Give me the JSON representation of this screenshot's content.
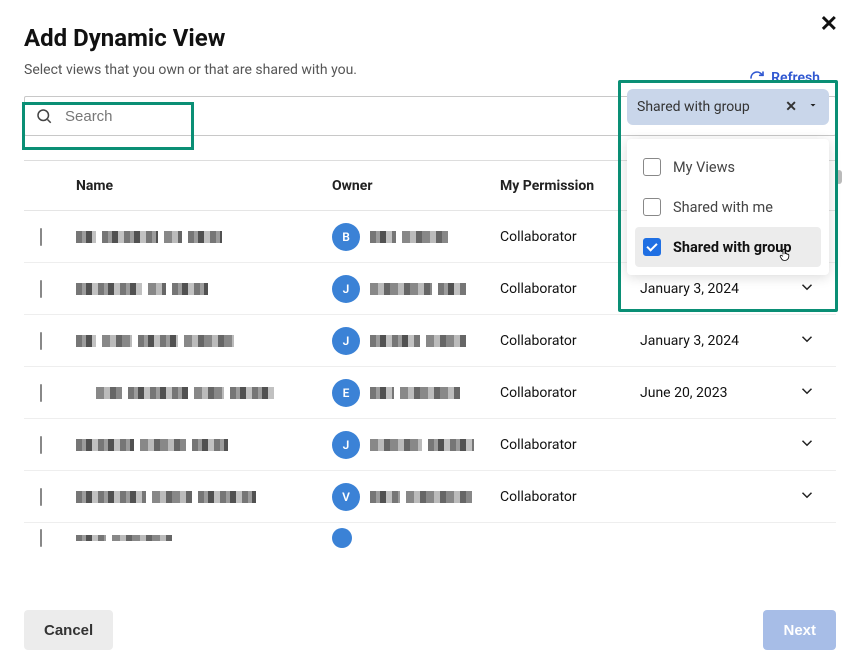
{
  "title": "Add Dynamic View",
  "subtitle": "Select views that you own or that are shared with you.",
  "refresh_label": "Refresh",
  "search": {
    "placeholder": "Search"
  },
  "filter": {
    "chip_label": "Shared with group",
    "options": [
      {
        "label": "My Views",
        "checked": false
      },
      {
        "label": "Shared with me",
        "checked": false
      },
      {
        "label": "Shared with group",
        "checked": true
      }
    ]
  },
  "columns": {
    "name": "Name",
    "owner": "Owner",
    "permission": "My Permission"
  },
  "rows": [
    {
      "avatar": "B",
      "permission": "Collaborator",
      "last": ""
    },
    {
      "avatar": "J",
      "permission": "Collaborator",
      "last": "January 3, 2024"
    },
    {
      "avatar": "J",
      "permission": "Collaborator",
      "last": "January 3, 2024"
    },
    {
      "avatar": "E",
      "permission": "Collaborator",
      "last": "June 20, 2023"
    },
    {
      "avatar": "J",
      "permission": "Collaborator",
      "last": ""
    },
    {
      "avatar": "V",
      "permission": "Collaborator",
      "last": ""
    },
    {
      "avatar": "",
      "permission": "",
      "last": ""
    }
  ],
  "buttons": {
    "cancel": "Cancel",
    "next": "Next"
  }
}
